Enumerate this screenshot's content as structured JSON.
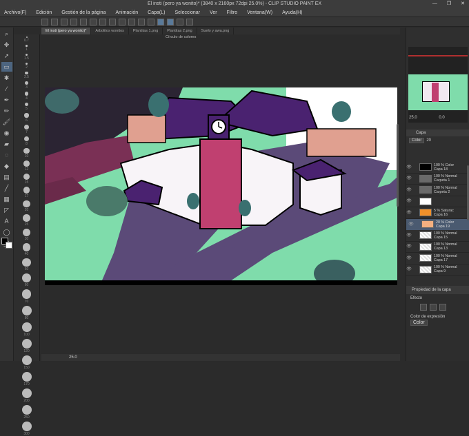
{
  "window": {
    "title": "El insti (pero ya wonito)* (3840 x 2160px 72dpi 25.0%) - CLIP STUDIO PAINT EX",
    "controls": [
      "—",
      "❐",
      "✕"
    ]
  },
  "menu": [
    "Archivo(F)",
    "Edición",
    "Gestión de la página",
    "Animación",
    "Capa(L)",
    "Seleccionar",
    "Ver",
    "Filtro",
    "Ventana(W)",
    "Ayuda(H)"
  ],
  "tabs": [
    "El insti (pero ya wonito)*",
    "Arbolitos wonitos",
    "Plantitas 1.png",
    "Plantitas 2.png",
    "Suelo y awa.png"
  ],
  "canvas": {
    "panel_label": "Círculo de colores"
  },
  "status": {
    "zoom": "25.0"
  },
  "brush_sizes": [
    "0.7",
    "1",
    "1.5",
    "2",
    "2.5",
    "3",
    "4",
    "5",
    "6",
    "7",
    "8",
    "10",
    "12",
    "15",
    "17",
    "20",
    "25",
    "30",
    "40",
    "50",
    "60",
    "70",
    "80",
    "100",
    "120",
    "150",
    "170",
    "200",
    "250",
    "300"
  ],
  "navigator": {
    "zoom": "25.0",
    "rotate": "0.0"
  },
  "layer_panel": {
    "title": "Capa",
    "blend_mode": "Color",
    "opacity": "20",
    "layers": [
      {
        "line1": "100 % Color",
        "line2": "Capa 18",
        "thumb": "#000000"
      },
      {
        "line1": "100 % Normal",
        "line2": "Carpeta 1",
        "thumb": "folder"
      },
      {
        "line1": "100 % Normal",
        "line2": "Carpeta 2",
        "thumb": "folder"
      },
      {
        "line1": "",
        "line2": "",
        "thumb": "#ffffff"
      },
      {
        "line1": "5 % Saturac",
        "line2": "Capa 16",
        "thumb": "#f0902a"
      },
      {
        "line1": "20 % Color",
        "line2": "Capa 19",
        "thumb": "#f4b080"
      },
      {
        "line1": "100 % Normal",
        "line2": "Capa 15",
        "thumb": "checker"
      },
      {
        "line1": "100 % Normal",
        "line2": "Capa 13",
        "thumb": "checker"
      },
      {
        "line1": "100 % Normal",
        "line2": "Capa 17",
        "thumb": "checker"
      },
      {
        "line1": "100 % Normal",
        "line2": "Capa 9",
        "thumb": "checker"
      }
    ]
  },
  "layer_props": {
    "title": "Propiedad de la capa",
    "effect_label": "Efecto",
    "expr_label": "Color de expresión",
    "expr_value": "Color"
  }
}
